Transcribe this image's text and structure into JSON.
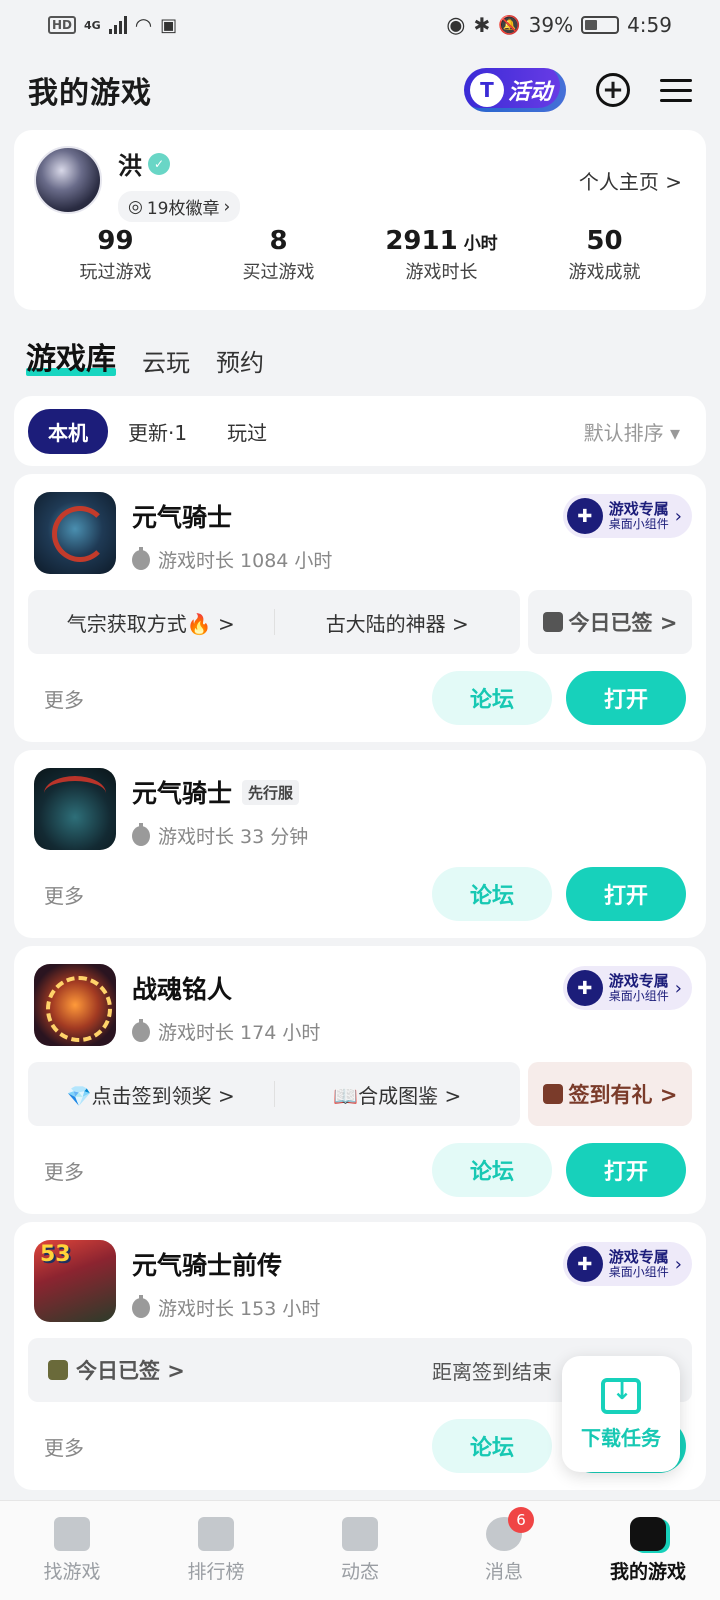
{
  "status_bar": {
    "network": "4G",
    "battery_percent": "39%",
    "time": "4:59",
    "battery_level": 0.39
  },
  "header": {
    "title": "我的游戏",
    "activity_label": "活动"
  },
  "profile": {
    "username": "洪",
    "badges": "19枚徽章",
    "homepage_link": "个人主页 >",
    "stats": [
      {
        "value": "99",
        "unit": "",
        "label": "玩过游戏"
      },
      {
        "value": "8",
        "unit": "",
        "label": "买过游戏"
      },
      {
        "value": "2911",
        "unit": "小时",
        "label": "游戏时长"
      },
      {
        "value": "50",
        "unit": "",
        "label": "游戏成就"
      }
    ]
  },
  "library_tabs": [
    "游戏库",
    "云玩",
    "预约"
  ],
  "filters": {
    "chips": [
      "本机",
      "更新·1",
      "玩过"
    ],
    "sort": "默认排序 ▾"
  },
  "widget_badge": {
    "main": "游戏专属",
    "sub": "桌面小组件"
  },
  "games": [
    {
      "title": "元气骑士",
      "playtime": "游戏时长 1084 小时",
      "links": [
        "气宗获取方式🔥 >",
        "古大陆的神器 >"
      ],
      "sign": "今日已签 >",
      "more": "更多",
      "forum": "论坛",
      "open": "打开"
    },
    {
      "title": "元气骑士",
      "tag": "先行服",
      "playtime": "游戏时长 33 分钟",
      "more": "更多",
      "forum": "论坛",
      "open": "打开"
    },
    {
      "title": "战魂铭人",
      "playtime": "游戏时长 174 小时",
      "links": [
        "💎点击签到领奖 >",
        "📖合成图鉴 >"
      ],
      "sign": "签到有礼 >",
      "more": "更多",
      "forum": "论坛",
      "open": "打开"
    },
    {
      "title": "元气骑士前传",
      "playtime": "游戏时长 153 小时",
      "signin_done": "今日已签 >",
      "countdown": "距离签到结束",
      "more": "更多",
      "forum": "论坛",
      "open": "打开"
    }
  ],
  "download_task": {
    "label": "下载任务"
  },
  "bottom_nav": [
    {
      "label": "找游戏"
    },
    {
      "label": "排行榜"
    },
    {
      "label": "动态"
    },
    {
      "label": "消息",
      "badge": "6"
    },
    {
      "label": "我的游戏"
    }
  ]
}
